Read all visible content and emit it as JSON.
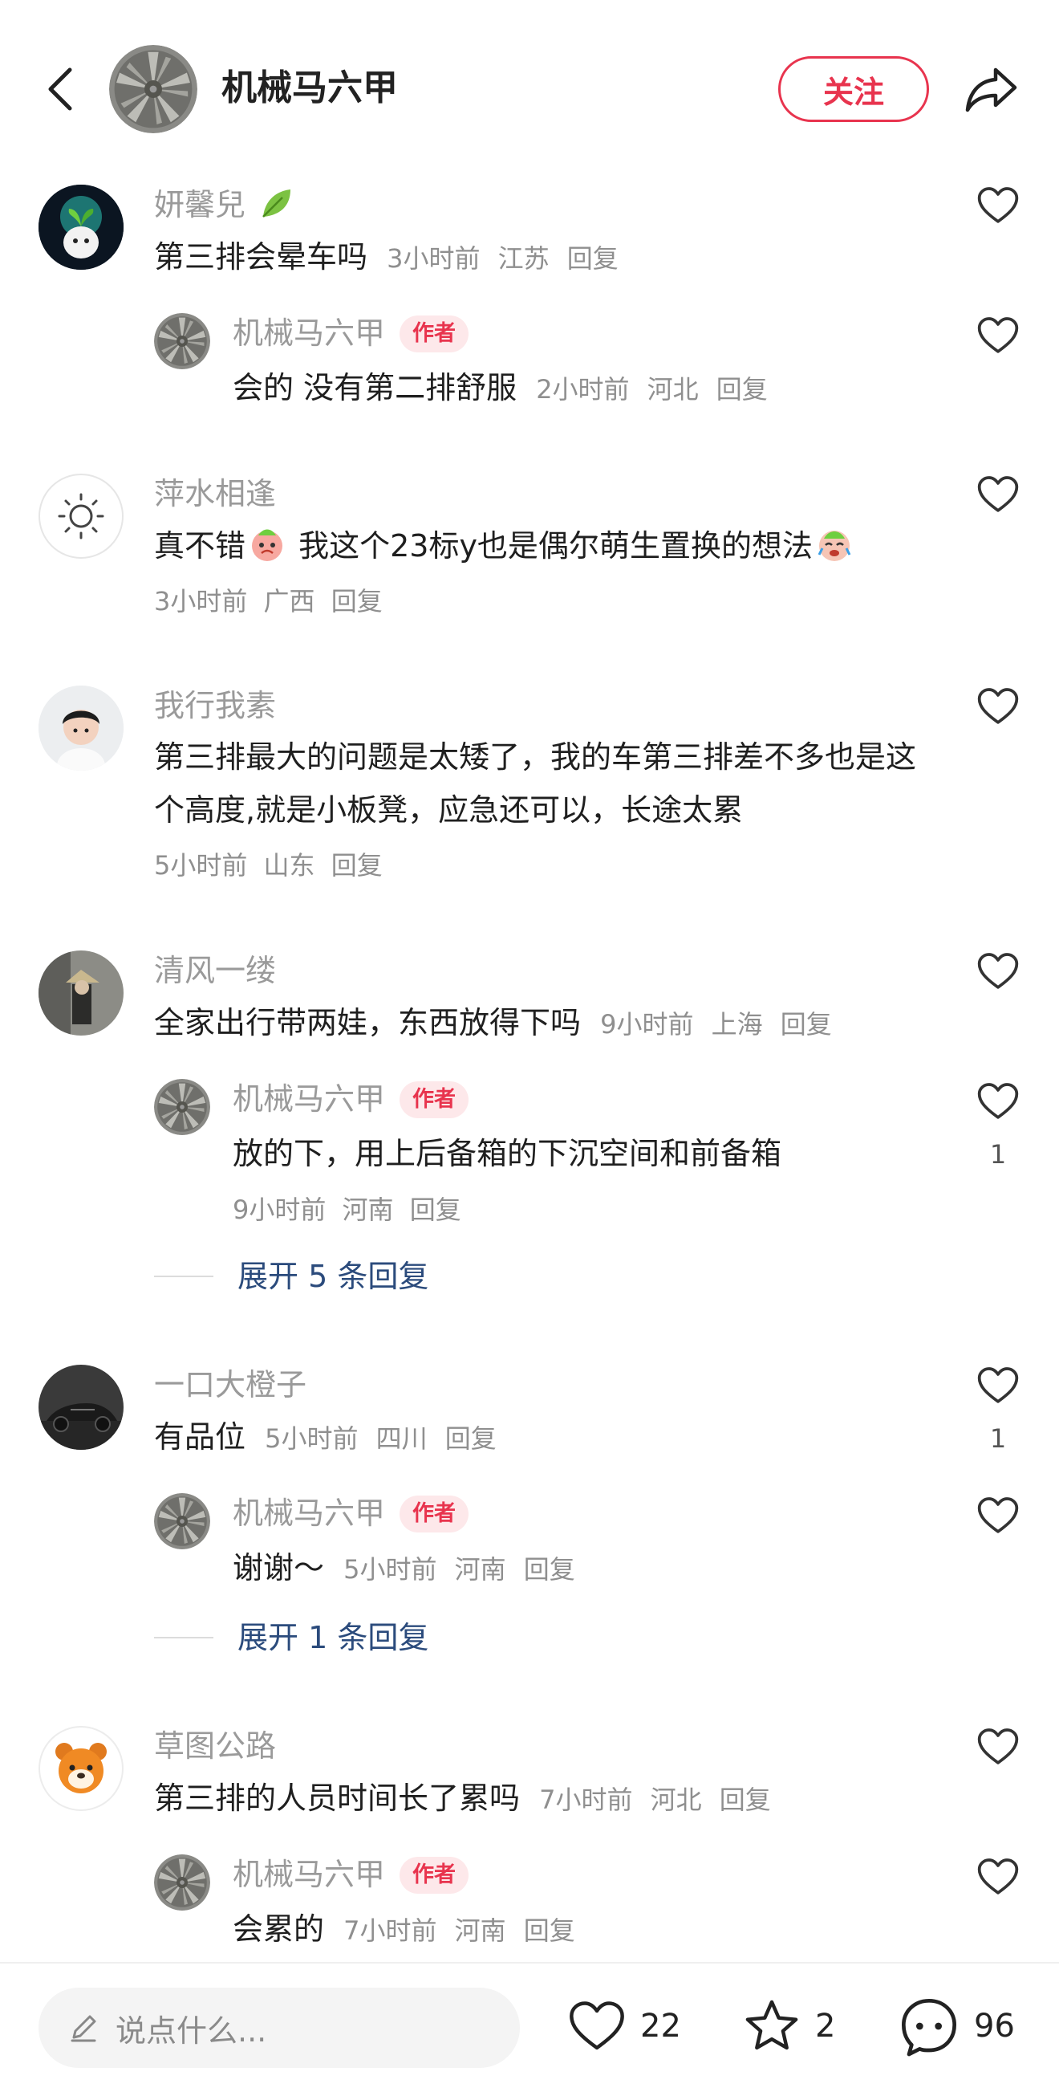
{
  "header": {
    "account_name": "机械马六甲",
    "follow_label": "关注"
  },
  "comments": [
    {
      "user": "妍馨兒",
      "text": "第三排会晕车吗",
      "time": "3小时前",
      "location": "江苏",
      "reply": "回复",
      "replies": [
        {
          "user": "机械马六甲",
          "tag": "作者",
          "text": "会的 没有第二排舒服",
          "time": "2小时前",
          "location": "河北",
          "reply": "回复"
        }
      ]
    },
    {
      "user": "萍水相逢",
      "text_a": "真不错",
      "text_b": " 我这个23标y也是偶尔萌生置换的想法",
      "time": "3小时前",
      "location": "广西",
      "reply": "回复"
    },
    {
      "user": "我行我素",
      "text": "第三排最大的问题是太矮了，我的车第三排差不多也是这个高度,就是小板凳，应急还可以，长途太累",
      "time": "5小时前",
      "location": "山东",
      "reply": "回复"
    },
    {
      "user": "清风一缕",
      "text": "全家出行带两娃，东西放得下吗",
      "time": "9小时前",
      "location": "上海",
      "reply": "回复",
      "replies": [
        {
          "user": "机械马六甲",
          "tag": "作者",
          "text": "放的下，用上后备箱的下沉空间和前备箱",
          "time": "9小时前",
          "location": "河南",
          "reply": "回复",
          "likes": "1"
        }
      ],
      "expand": "展开 5 条回复"
    },
    {
      "user": "一口大橙子",
      "text": "有品位",
      "time": "5小时前",
      "location": "四川",
      "reply": "回复",
      "likes": "1",
      "replies": [
        {
          "user": "机械马六甲",
          "tag": "作者",
          "text": "谢谢～",
          "time": "5小时前",
          "location": "河南",
          "reply": "回复"
        }
      ],
      "expand": "展开 1 条回复"
    },
    {
      "user": "草图公路",
      "text": "第三排的人员时间长了累吗",
      "time": "7小时前",
      "location": "河北",
      "reply": "回复",
      "replies": [
        {
          "user": "机械马六甲",
          "tag": "作者",
          "text": "会累的",
          "time": "7小时前",
          "location": "河南",
          "reply": "回复"
        }
      ]
    }
  ],
  "bottom": {
    "input_placeholder": "说点什么...",
    "likes": "22",
    "favorites": "2",
    "comments": "96"
  },
  "colors": {
    "accent": "#e8344e",
    "link": "#2b4b7c",
    "meta": "#8f8f8f"
  }
}
